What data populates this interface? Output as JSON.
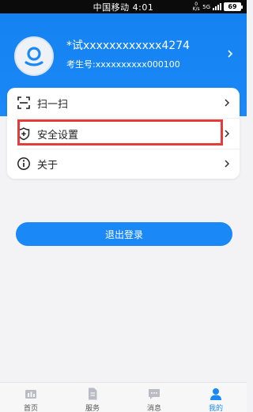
{
  "status_bar": {
    "carrier": "中国移动 4:01",
    "speed_value": "0",
    "speed_unit": "K/s",
    "network": "5G",
    "battery": "69"
  },
  "profile": {
    "name": "*试xxxxxxxxxxxx4274",
    "student_id_label": "考生号:",
    "student_id_value": "xxxxxxxxxx000100"
  },
  "menu": [
    {
      "label": "扫一扫",
      "icon": "scan-icon"
    },
    {
      "label": "安全设置",
      "icon": "shield-plus-icon"
    },
    {
      "label": "关于",
      "icon": "info-icon"
    }
  ],
  "logout_label": "退出登录",
  "bottom_nav": [
    {
      "label": "首页",
      "icon": "home-icon",
      "active": false
    },
    {
      "label": "服务",
      "icon": "service-icon",
      "active": false
    },
    {
      "label": "消息",
      "icon": "message-icon",
      "active": false
    },
    {
      "label": "我的",
      "icon": "user-icon",
      "active": true
    }
  ],
  "colors": {
    "primary": "#1a88f6",
    "highlight_box": "#e43b3b",
    "background": "#f3f3f5"
  }
}
